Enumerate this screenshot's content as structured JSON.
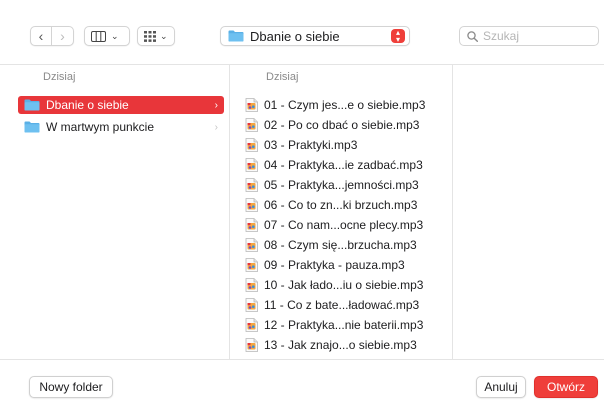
{
  "toolbar": {
    "nav_back": "‹",
    "nav_forward": "›",
    "view_icon": "column-view-icon",
    "grid_icon": "grid-view-icon",
    "path_label": "Dbanie o siebie",
    "search_placeholder": "Szukaj"
  },
  "sidebar": {
    "header": "Dzisiaj",
    "items": [
      {
        "label": "Dbanie o siebie",
        "selected": true
      },
      {
        "label": "W martwym punkcie",
        "selected": false
      }
    ]
  },
  "files": {
    "header": "Dzisiaj",
    "items": [
      "01 - Czym jes...e o siebie.mp3",
      "02 - Po co dbać o siebie.mp3",
      "03 - Praktyki.mp3",
      "04 - Praktyka...ie zadbać.mp3",
      "05 - Praktyka...jemności.mp3",
      "06 - Co to zn...ki brzuch.mp3",
      "07 - Co nam...ocne plecy.mp3",
      "08 - Czym się...brzucha.mp3",
      "09 - Praktyka - pauza.mp3",
      "10 - Jak ładо...iu o siebie.mp3",
      "11 - Co z bate...ładować.mp3",
      "12 - Praktyka...nie baterii.mp3",
      "13 - Jak znajo...o siebie.mp3"
    ]
  },
  "footer": {
    "new_folder": "Nowy folder",
    "cancel": "Anuluj",
    "open": "Otwórz"
  },
  "colors": {
    "accent": "#e8363a",
    "folder": "#5ab0e6"
  }
}
